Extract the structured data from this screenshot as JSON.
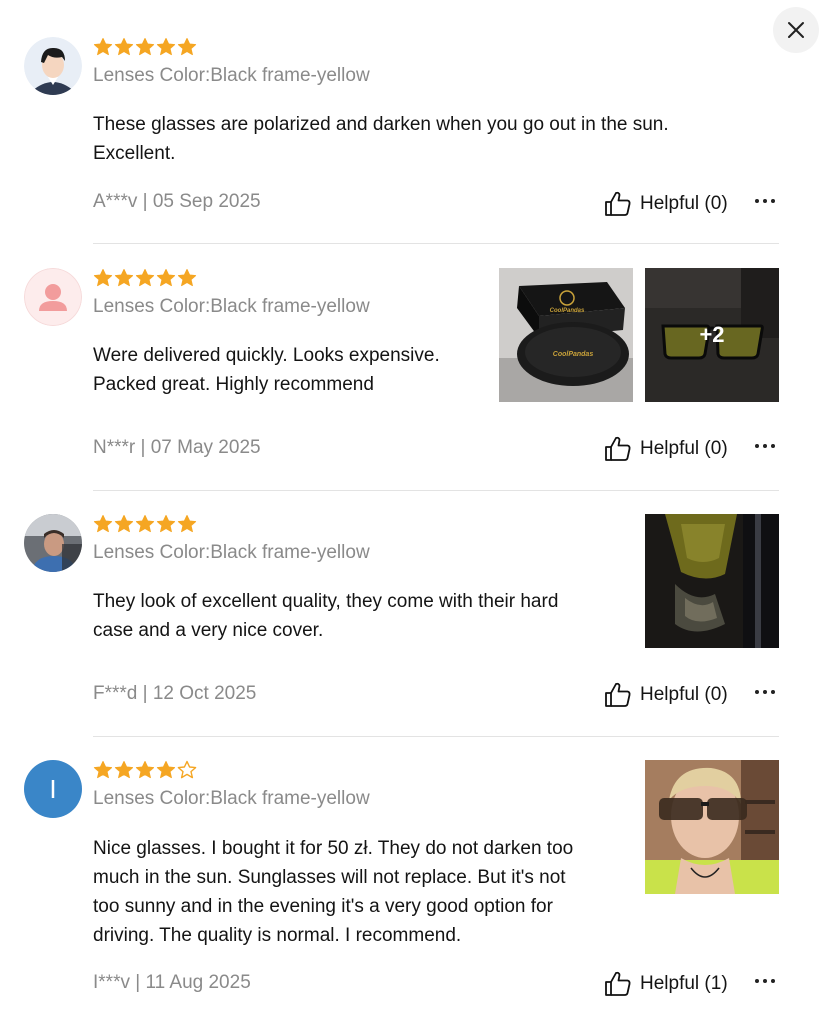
{
  "close_label": "close",
  "colors": {
    "star": "#f5a623",
    "star_empty_stroke": "#f5a623",
    "meta_gray": "#8a8a8a",
    "divider": "#e3e3e3",
    "letter_avatar_bg": "#3a86c8"
  },
  "reviews": [
    {
      "avatar": "male-avatar-icon",
      "rating": 5,
      "max_rating": 5,
      "variant": "Lenses Color:Black frame-yellow",
      "text_lines": [
        "These glasses are polarized and darken when you go out in the sun.",
        "Excellent."
      ],
      "meta": "A***v | 05 Sep 2025",
      "helpful_label": "Helpful (0)",
      "photos": []
    },
    {
      "avatar": "female-avatar-icon",
      "rating": 5,
      "max_rating": 5,
      "variant": "Lenses Color:Black frame-yellow",
      "text_lines": [
        "Were delivered quickly. Looks expensive.",
        "Packed great. Highly recommend"
      ],
      "meta": "N***r | 07 May 2025",
      "helpful_label": "Helpful (0)",
      "photos": [
        {
          "name": "photo-glasses-case-box",
          "brand_text": "CoolPandas",
          "brand_text_2": "CoolPandas"
        },
        {
          "name": "photo-glasses-on-floor",
          "overlay": "+2"
        }
      ]
    },
    {
      "avatar": "photo-avatar-man-in-car",
      "rating": 5,
      "max_rating": 5,
      "variant": "Lenses Color:Black frame-yellow",
      "text_lines": [
        "They look of excellent quality, they come with their hard",
        "case and a very nice cover."
      ],
      "meta": "F***d | 12 Oct 2025",
      "helpful_label": "Helpful (0)",
      "photos": [
        {
          "name": "photo-yellow-lens-closeup"
        }
      ]
    },
    {
      "avatar": "letter-avatar",
      "avatar_letter": "I",
      "rating": 4,
      "max_rating": 5,
      "variant": "Lenses Color:Black frame-yellow",
      "text_lines": [
        "Nice glasses. I bought it for 50 zł. They do not darken too",
        "much in the sun. Sunglasses will not replace. But it's not",
        "too sunny and in the evening it's a very good option for",
        "driving. The quality is normal. I recommend."
      ],
      "meta": "I***v | 11 Aug 2025",
      "helpful_label": "Helpful (1)",
      "photos": [
        {
          "name": "photo-boy-wearing-glasses"
        }
      ]
    }
  ]
}
